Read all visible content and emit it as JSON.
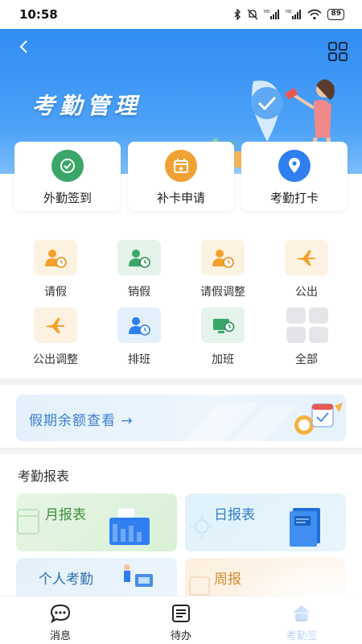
{
  "status_bar": {
    "time": "10:58",
    "battery": "89"
  },
  "hero": {
    "title": "考勤管理"
  },
  "quick_actions": [
    {
      "label": "外勤签到",
      "icon": "check-circle-icon",
      "color": "#3aa769"
    },
    {
      "label": "补卡申请",
      "icon": "calendar-add-icon",
      "color": "#f0a134"
    },
    {
      "label": "考勤打卡",
      "icon": "location-pin-icon",
      "color": "#2f7ff0"
    }
  ],
  "functions": [
    {
      "label": "请假",
      "icon": "person-clock-icon"
    },
    {
      "label": "销假",
      "icon": "person-clock-icon"
    },
    {
      "label": "请假调整",
      "icon": "person-clock-icon"
    },
    {
      "label": "公出",
      "icon": "airplane-icon"
    },
    {
      "label": "公出调整",
      "icon": "airplane-icon"
    },
    {
      "label": "排班",
      "icon": "person-clock-icon"
    },
    {
      "label": "加班",
      "icon": "monitor-clock-icon"
    },
    {
      "label": "全部",
      "icon": "grid-icon"
    }
  ],
  "balance_banner": {
    "text": "假期余额查看 →"
  },
  "reports": {
    "title": "考勤报表",
    "items": [
      {
        "label": "月报表"
      },
      {
        "label": "日报表"
      },
      {
        "label": "个人考勤"
      },
      {
        "label": "周报"
      }
    ]
  },
  "bottom_nav": [
    {
      "label": "消息",
      "icon": "chat-bubble-icon"
    },
    {
      "label": "待办",
      "icon": "list-icon"
    },
    {
      "label": "考勤签",
      "icon": "home-icon"
    }
  ],
  "colors": {
    "primary": "#2f7ff0",
    "green": "#3aa769",
    "orange": "#f0a134"
  }
}
